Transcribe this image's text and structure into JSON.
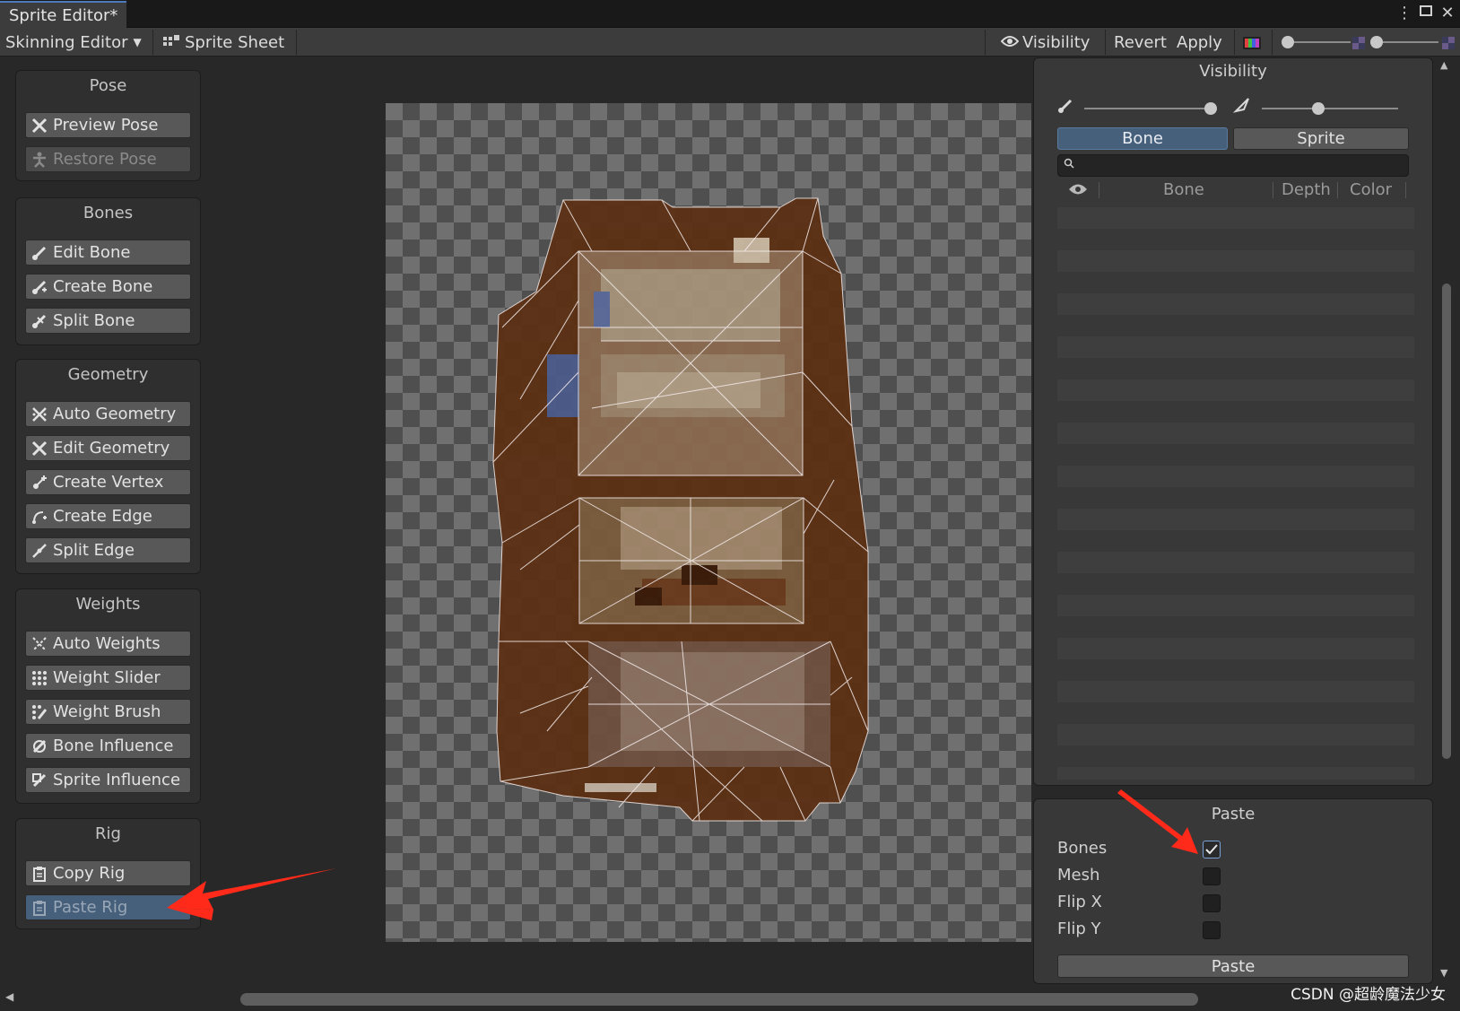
{
  "window": {
    "tab_title": "Sprite Editor*"
  },
  "toolbar": {
    "mode_dropdown": "Skinning Editor",
    "sprite_sheet": "Sprite Sheet",
    "visibility": "Visibility",
    "revert": "Revert",
    "apply": "Apply"
  },
  "panels": {
    "pose": {
      "title": "Pose",
      "buttons": [
        "Preview Pose",
        "Restore Pose"
      ]
    },
    "bones": {
      "title": "Bones",
      "buttons": [
        "Edit Bone",
        "Create Bone",
        "Split Bone"
      ]
    },
    "geometry": {
      "title": "Geometry",
      "buttons": [
        "Auto Geometry",
        "Edit Geometry",
        "Create Vertex",
        "Create Edge",
        "Split Edge"
      ]
    },
    "weights": {
      "title": "Weights",
      "buttons": [
        "Auto Weights",
        "Weight Slider",
        "Weight Brush",
        "Bone Influence",
        "Sprite Influence"
      ]
    },
    "rig": {
      "title": "Rig",
      "buttons": [
        "Copy Rig",
        "Paste Rig"
      ]
    }
  },
  "visibility_panel": {
    "title": "Visibility",
    "tabs": [
      "Bone",
      "Sprite"
    ],
    "active_tab": "Bone",
    "search_value": "",
    "columns": [
      "Bone",
      "Depth",
      "Color"
    ]
  },
  "paste_panel": {
    "title": "Paste",
    "options": [
      {
        "label": "Bones",
        "checked": true
      },
      {
        "label": "Mesh",
        "checked": false
      },
      {
        "label": "Flip X",
        "checked": false
      },
      {
        "label": "Flip Y",
        "checked": false
      }
    ],
    "button": "Paste"
  },
  "watermark": "CSDN @超龄魔法少女",
  "colors": {
    "accent": "#4d7ab8",
    "selected_tab": "#46607c",
    "annotation_arrow": "#ff2a1a"
  }
}
